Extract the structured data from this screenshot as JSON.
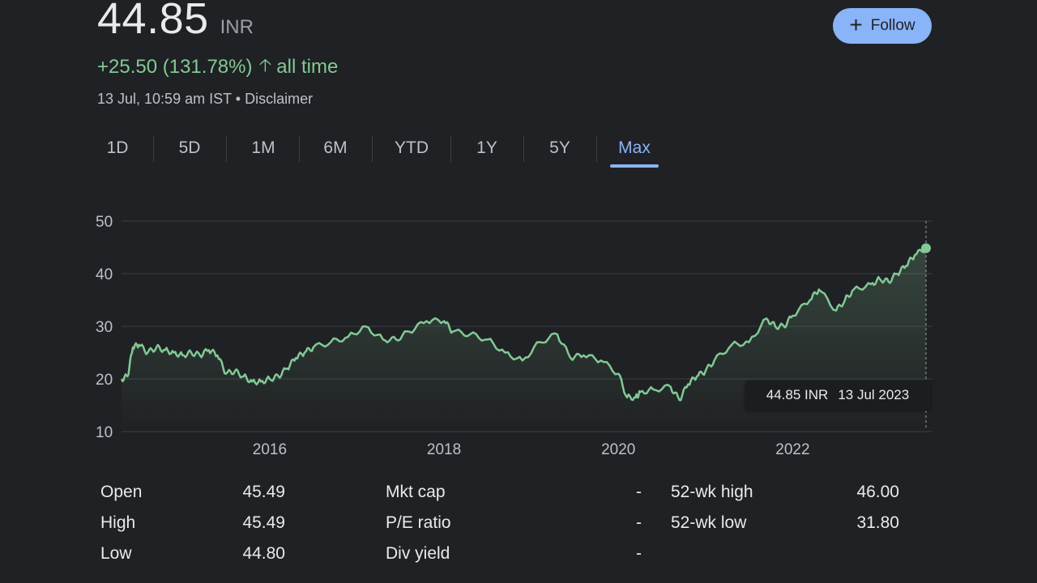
{
  "quote": {
    "price": "44.85",
    "currency": "INR",
    "change": "+25.50 (131.78%)",
    "period": "all time",
    "timestamp": "13 Jul, 10:59 am IST • Disclaimer"
  },
  "follow_label": "Follow",
  "tabs": [
    "1D",
    "5D",
    "1M",
    "6M",
    "YTD",
    "1Y",
    "5Y",
    "Max"
  ],
  "active_tab": "Max",
  "tooltip": {
    "price": "44.85 INR",
    "date": "13 Jul 2023"
  },
  "colors": {
    "line": "#81c995",
    "accent": "#8ab4f8",
    "background": "#202124"
  },
  "stats": [
    {
      "label": "Open",
      "value": "45.49"
    },
    {
      "label": "High",
      "value": "45.49"
    },
    {
      "label": "Low",
      "value": "44.80"
    },
    {
      "label": "Mkt cap",
      "value": "-"
    },
    {
      "label": "P/E ratio",
      "value": "-"
    },
    {
      "label": "Div yield",
      "value": "-"
    },
    {
      "label": "52-wk high",
      "value": "46.00"
    },
    {
      "label": "52-wk low",
      "value": "31.80"
    }
  ],
  "chart_data": {
    "type": "line",
    "y_ticks": [
      "50",
      "40",
      "30",
      "20",
      "10"
    ],
    "x_ticks": [
      "2016",
      "2018",
      "2020",
      "2022"
    ],
    "ylim": [
      10,
      50
    ],
    "xlim": [
      2014.3,
      2023.53
    ],
    "grid": true,
    "series": [
      {
        "x": [
          2014.3,
          2014.37,
          2014.43,
          2014.5,
          2014.6,
          2014.7,
          2014.8,
          2014.9,
          2015.0,
          2015.1,
          2015.2,
          2015.3,
          2015.4,
          2015.5,
          2015.6,
          2015.7,
          2015.8,
          2015.9,
          2016.0,
          2016.1,
          2016.2,
          2016.3,
          2016.4,
          2016.5,
          2016.7,
          2016.9,
          2017.1,
          2017.3,
          2017.45,
          2017.6,
          2017.8,
          2018.0,
          2018.1,
          2018.3,
          2018.5,
          2018.7,
          2018.9,
          2019.1,
          2019.3,
          2019.45,
          2019.6,
          2019.8,
          2020.0,
          2020.1,
          2020.2,
          2020.25,
          2020.4,
          2020.6,
          2020.7,
          2020.8,
          2020.9,
          2021.0,
          2021.1,
          2021.3,
          2021.5,
          2021.7,
          2021.8,
          2021.9,
          2022.0,
          2022.2,
          2022.3,
          2022.5,
          2022.6,
          2022.7,
          2022.9,
          2023.0,
          2023.1,
          2023.2,
          2023.3,
          2023.4,
          2023.53
        ],
        "y": [
          20,
          20.5,
          26,
          26.5,
          25,
          26,
          25.5,
          25,
          24.5,
          25,
          24.5,
          25.5,
          24.5,
          21,
          21.5,
          20.5,
          19.5,
          19.5,
          20,
          20.5,
          22,
          24,
          25,
          26,
          27,
          28,
          30,
          27.5,
          27.5,
          29,
          31,
          31,
          29,
          28.5,
          27.5,
          25,
          23.5,
          27,
          28.5,
          24,
          24.5,
          23.5,
          21,
          16.5,
          16.5,
          17.5,
          18,
          18.5,
          16,
          19,
          20.5,
          21.5,
          23.5,
          26.5,
          27,
          31.5,
          30,
          30,
          32,
          35,
          37,
          33,
          35,
          37,
          38,
          39,
          38.5,
          40,
          41.5,
          43.5,
          44.85
        ]
      }
    ]
  },
  "chart_colors": {
    "grid": "#3c4043",
    "text": "#bdc1c6",
    "area_top": "rgba(129,201,149,0.22)"
  }
}
